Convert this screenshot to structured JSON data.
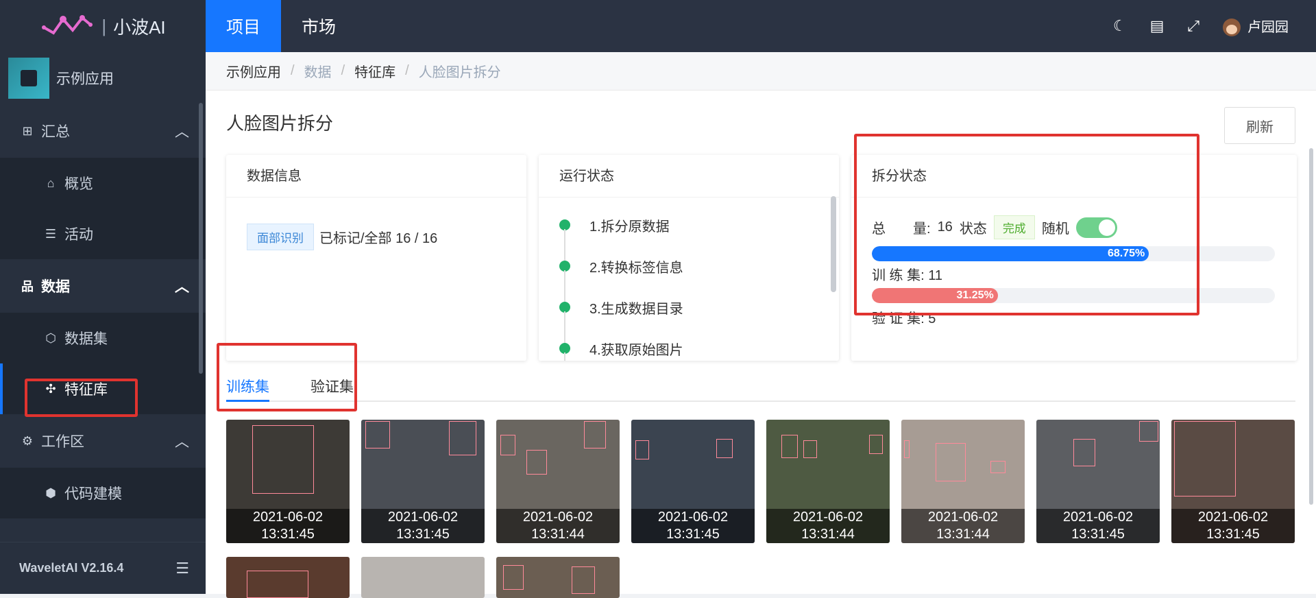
{
  "app": {
    "logo_text": "小波AI",
    "sep": "|",
    "current_app": "示例应用",
    "version": "WaveletAI V2.16.4"
  },
  "sidebar": {
    "groups": [
      {
        "label": "汇总",
        "children": [
          "概览",
          "活动"
        ]
      },
      {
        "label": "数据",
        "children": [
          "数据集",
          "特征库"
        ]
      },
      {
        "label": "工作区",
        "children": [
          "代码建模"
        ]
      }
    ],
    "selected": "特征库"
  },
  "topbar": {
    "tabs": [
      "项目",
      "市场"
    ],
    "active_tab": "项目",
    "user": "卢园园"
  },
  "breadcrumb": [
    "示例应用",
    "数据",
    "特征库",
    "人脸图片拆分"
  ],
  "page": {
    "title": "人脸图片拆分",
    "refresh_label": "刷新"
  },
  "data_info": {
    "title": "数据信息",
    "tag": "面部识别",
    "text": "已标记/全部 16 / 16"
  },
  "run_state": {
    "title": "运行状态",
    "steps": [
      "1.拆分原数据",
      "2.转换标签信息",
      "3.生成数据目录",
      "4.获取原始图片"
    ]
  },
  "split_state": {
    "title": "拆分状态",
    "total_label": "总　　量:",
    "total": "16",
    "status_label": "状态",
    "status": "完成",
    "random_label": "随机",
    "random_on": true,
    "train_pct": "68.75%",
    "train_fraction": 0.6875,
    "train_label": "训 练 集: 11",
    "val_pct": "31.25%",
    "val_fraction": 0.3125,
    "val_label": "验 证 集: 5",
    "train_color": "#1677ff",
    "val_color": "#f07575"
  },
  "sets": {
    "tabs": [
      "训练集",
      "验证集"
    ],
    "active": "训练集"
  },
  "thumbnails": [
    {
      "date": "2021-06-02",
      "time": "13:31:45"
    },
    {
      "date": "2021-06-02",
      "time": "13:31:45"
    },
    {
      "date": "2021-06-02",
      "time": "13:31:44"
    },
    {
      "date": "2021-06-02",
      "time": "13:31:45"
    },
    {
      "date": "2021-06-02",
      "time": "13:31:44"
    },
    {
      "date": "2021-06-02",
      "time": "13:31:44"
    },
    {
      "date": "2021-06-02",
      "time": "13:31:45"
    },
    {
      "date": "2021-06-02",
      "time": "13:31:45"
    }
  ],
  "colors": {
    "accent": "#1677ff",
    "sidebar_bg": "#28303e",
    "highlight": "#e0332f"
  }
}
